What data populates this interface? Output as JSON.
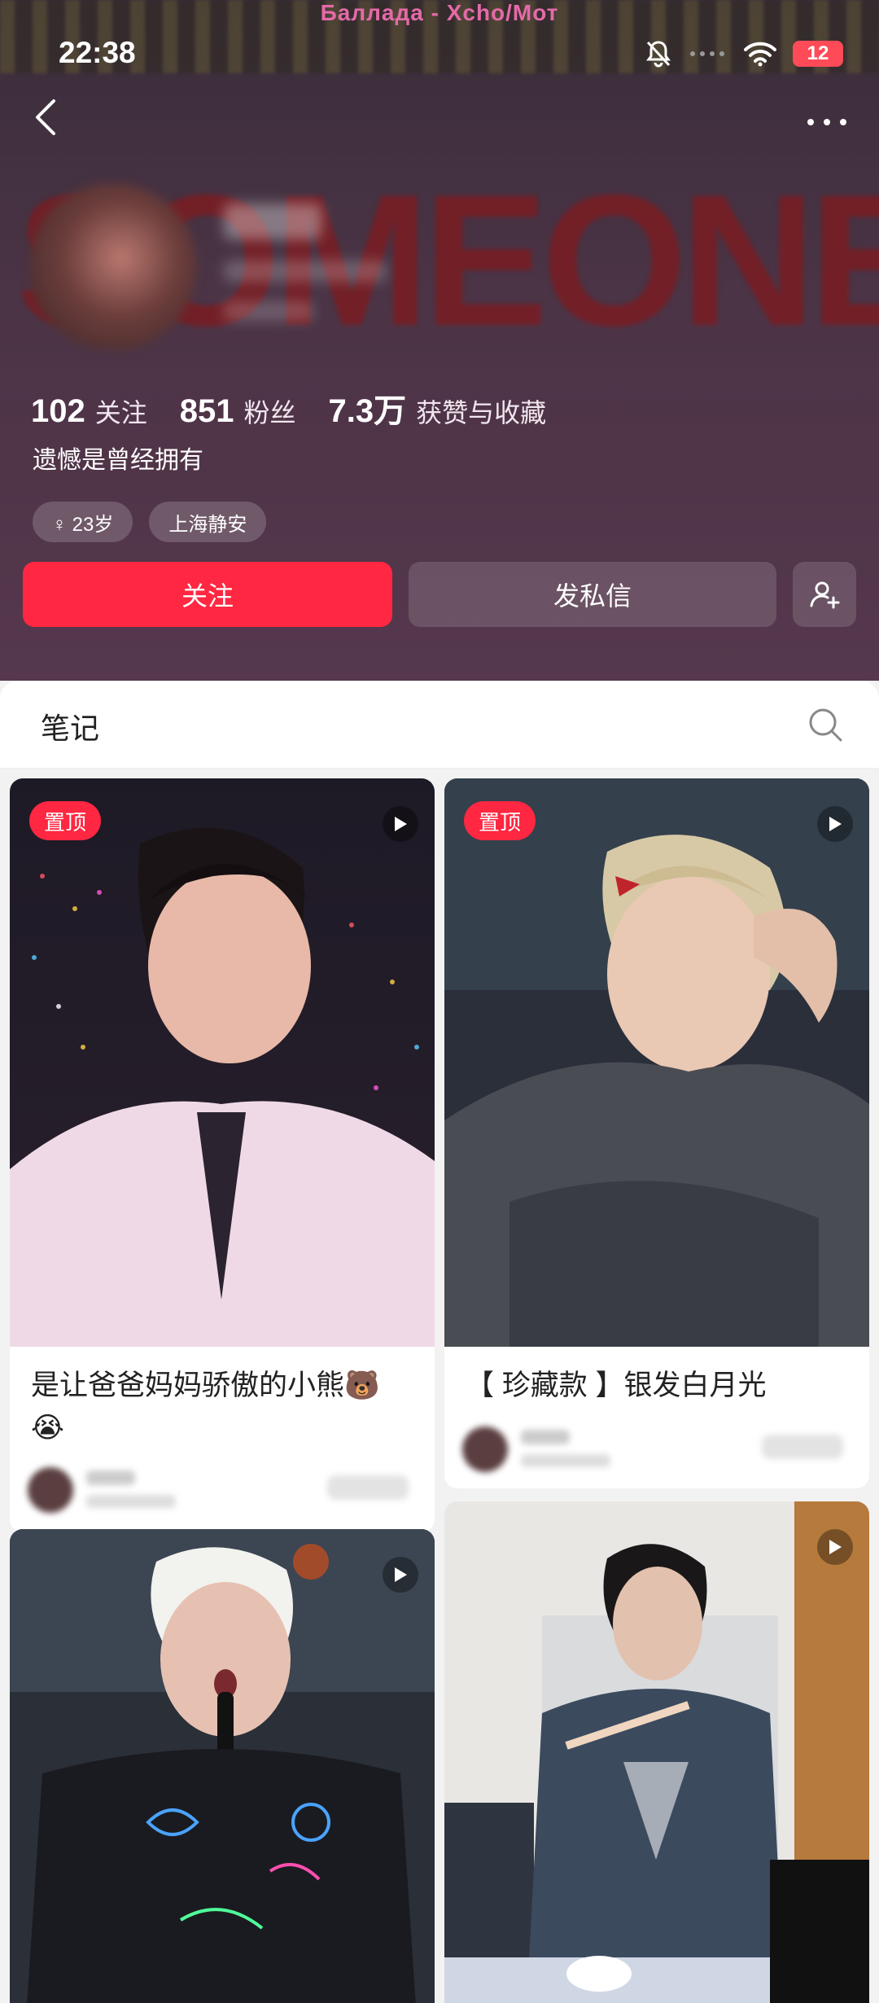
{
  "media": {
    "now_playing": "Баллада - Xcho/Мот"
  },
  "status_bar": {
    "time": "22:38",
    "battery": "12"
  },
  "profile": {
    "background_text": "SOMEONE",
    "stats": [
      {
        "value": "102",
        "label": "关注"
      },
      {
        "value": "851",
        "label": "粉丝"
      },
      {
        "value": "7.3万",
        "label": "获赞与收藏"
      }
    ],
    "bio": "遗憾是曾经拥有",
    "tags": [
      {
        "icon": "female-icon",
        "text": "♀ 23岁"
      },
      {
        "icon": "",
        "text": "上海静安"
      }
    ],
    "follow_label": "关注",
    "message_label": "发私信"
  },
  "notes_tab": {
    "title": "笔记"
  },
  "feed": {
    "cards": [
      {
        "pinned_label": "置顶",
        "title_line1": "是让爸爸妈妈骄傲的小熊🐻",
        "title_line2": "😭",
        "video": true
      },
      {
        "pinned_label": "置顶",
        "title_line1": "【 珍藏款 】银发白月光",
        "title_line2": "",
        "video": true
      },
      {
        "pinned_label": "",
        "title_line1": "",
        "title_line2": "",
        "video": true
      },
      {
        "pinned_label": "",
        "title_line1": "",
        "title_line2": "",
        "video": true
      }
    ]
  },
  "colors": {
    "accent": "#ff2741",
    "header_bg": "#4b3446",
    "music_title": "#e46aa8"
  }
}
